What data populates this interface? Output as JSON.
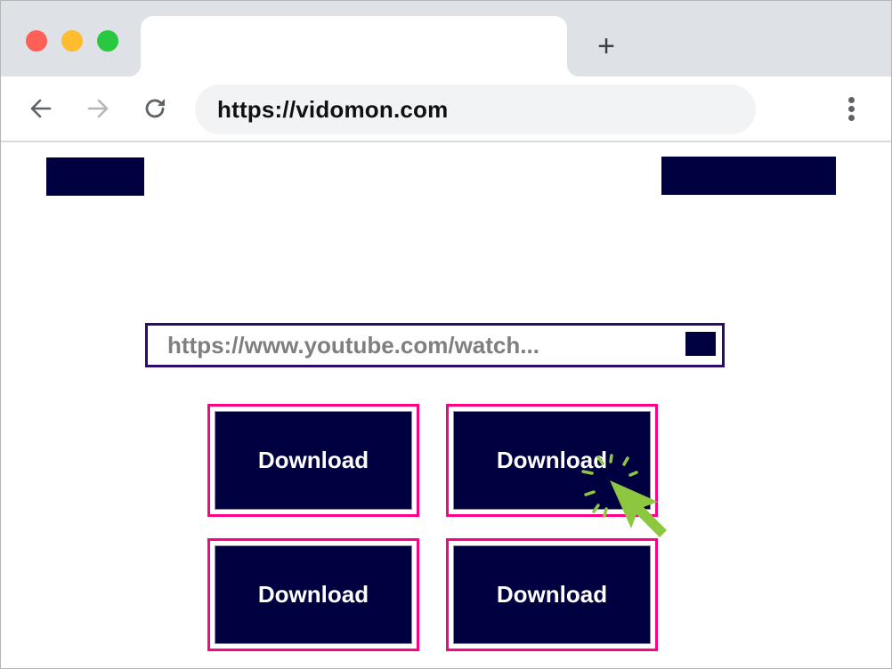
{
  "browser": {
    "window_controls": [
      "close",
      "minimize",
      "maximize"
    ],
    "tab": {
      "title": ""
    },
    "new_tab_label": "+",
    "nav": {
      "back_icon": "arrow-left-icon",
      "forward_icon": "arrow-right-icon",
      "reload_icon": "reload-icon",
      "menu_icon": "kebab-menu-icon"
    },
    "address_bar": {
      "url": "https://vidomon.com"
    }
  },
  "page": {
    "url_input": {
      "value": "https://www.youtube.com/watch...",
      "placeholder": ""
    },
    "download_buttons": [
      {
        "label": "Download"
      },
      {
        "label": "Download"
      },
      {
        "label": "Download"
      },
      {
        "label": "Download"
      }
    ],
    "cursor": {
      "icon": "click-pointer-icon",
      "target_button_index": 1
    }
  },
  "colors": {
    "tab_strip": "#dee1e6",
    "omnibox": "#f1f3f4",
    "navy": "#000040",
    "input_border": "#2e0b6b",
    "button_outline": "#ff0087",
    "cursor": "#8dc63f",
    "close": "#fe5f57",
    "minimize": "#febc2e",
    "maximize": "#28c840"
  }
}
